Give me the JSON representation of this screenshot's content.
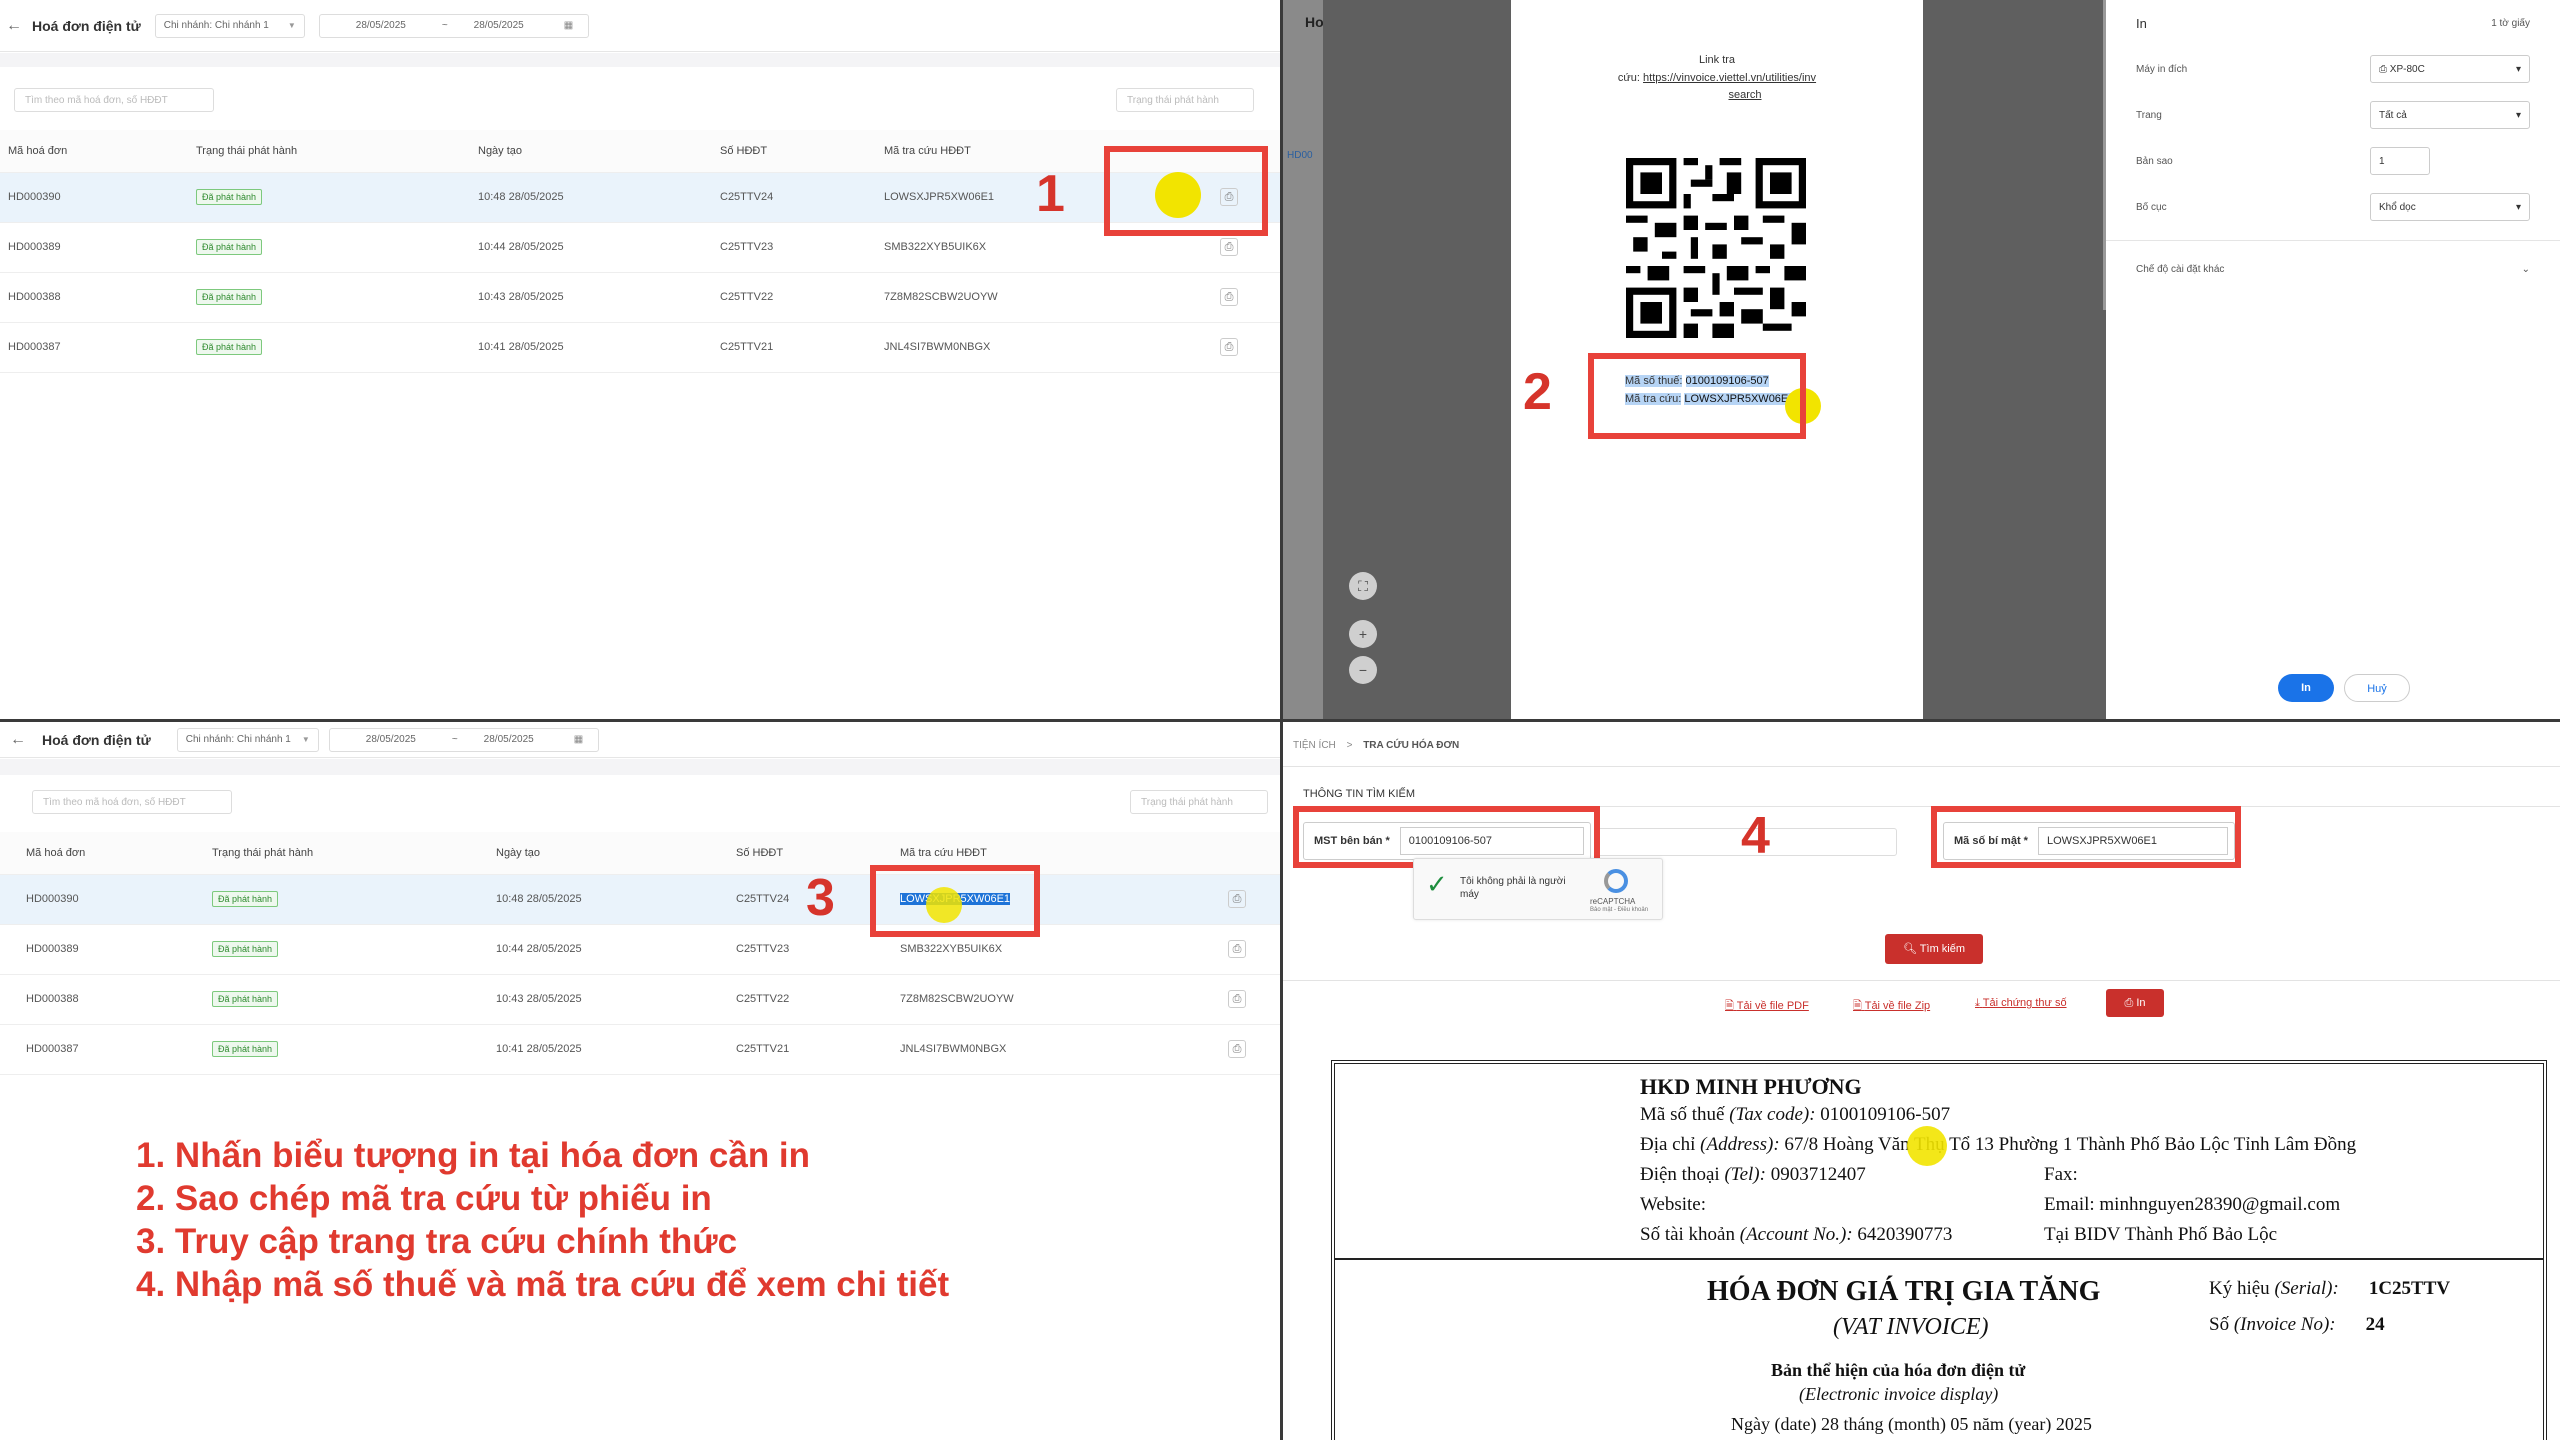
{
  "list": {
    "title": "Hoá đơn điện tử",
    "branch": "Chi nhánh: Chi nhánh 1",
    "date_from": "28/05/2025",
    "date_sep": "~",
    "date_to": "28/05/2025",
    "search_placeholder": "Tìm theo mã hoá đơn, số HĐĐT",
    "status_placeholder": "Trạng thái phát hành",
    "columns": [
      "Mã hoá đơn",
      "Trạng thái phát hành",
      "Ngày tạo",
      "Số HĐĐT",
      "Mã tra cứu HĐĐT"
    ],
    "rows": [
      {
        "code": "HD000390",
        "status": "Đã phát hành",
        "date": "10:48 28/05/2025",
        "number": "C25TTV24",
        "lookup": "LOWSXJPR5XW06E1"
      },
      {
        "code": "HD000389",
        "status": "Đã phát hành",
        "date": "10:44 28/05/2025",
        "number": "C25TTV23",
        "lookup": "SMB322XYB5UIK6X"
      },
      {
        "code": "HD000388",
        "status": "Đã phát hành",
        "date": "10:43 28/05/2025",
        "number": "C25TTV22",
        "lookup": "7Z8M82SCBW2UOYW"
      },
      {
        "code": "HD000387",
        "status": "Đã phát hành",
        "date": "10:41 28/05/2025",
        "number": "C25TTV21",
        "lookup": "JNL4SI7BWM0NBGX"
      }
    ]
  },
  "print_dialog": {
    "bg_title": "Ho",
    "bg_code": "HD00",
    "link_label": "Link tra",
    "link_label2": "cứu:",
    "link_url": "https://vinvoice.viettel.vn/utilities/inv",
    "link_url2": "search",
    "tax_label": "Mã số thuế:",
    "tax_value": "0100109106-507",
    "lookup_label": "Mã tra cứu:",
    "lookup_value": "LOWSXJPR5XW06E1",
    "panel_title": "In",
    "sheets": "1 tờ giấy",
    "printer_label": "Máy in đích",
    "printer_value": "XP-80C",
    "pages_label": "Trang",
    "pages_value": "Tất cả",
    "copies_label": "Bản sao",
    "copies_value": "1",
    "layout_label": "Bố cục",
    "layout_value": "Khổ dọc",
    "more_settings": "Chế độ cài đặt khác",
    "print_button": "In",
    "cancel_button": "Huỷ"
  },
  "annotations": {
    "n1": "1",
    "n2": "2",
    "n3": "3",
    "n4": "4"
  },
  "caption": [
    "1. Nhấn biểu tượng in tại hóa đơn cần in",
    "2. Sao chép mã tra cứu từ phiếu in",
    "3. Truy cập trang tra cứu chính thức",
    "4. Nhập mã số thuế và mã tra cứu để xem chi tiết"
  ],
  "lookup_page": {
    "crumb1": "TIỆN ÍCH",
    "crumb_sep": ">",
    "crumb2": "TRA CỨU HÓA ĐƠN",
    "section": "THÔNG TIN TÌM KIẾM",
    "mst_label": "MST bên bán *",
    "mst_value": "0100109106-507",
    "secret_label": "Mã số bí mật *",
    "secret_value": "LOWSXJPR5XW06E1",
    "captcha_text": "Tôi không phải là người máy",
    "captcha_brand": "reCAPTCHA",
    "captcha_terms": "Bảo mật - Điều khoản",
    "search_button": "Tìm kiếm",
    "dl_pdf": "Tải về file PDF",
    "dl_zip": "Tải về file Zip",
    "dl_cert": "Tải chứng thư số",
    "print_button": "In"
  },
  "invoice": {
    "company": "HKD MINH PHƯƠNG",
    "tax_line_a": "Mã số thuế ",
    "tax_line_b": "(Tax code):",
    "tax_line_c": " 0100109106-507",
    "addr_a": "Địa chỉ ",
    "addr_b": "(Address):",
    "addr_c": " 67/8 Hoàng Văn Thụ Tổ 13 Phường 1 Thành Phố Bảo Lộc Tỉnh Lâm Đồng",
    "tel_a": "Điện thoại ",
    "tel_b": "(Tel):",
    "tel_c": " 0903712407",
    "fax": "Fax:",
    "website": "Website:",
    "email": "Email: minhnguyen28390@gmail.com",
    "acc_a": "Số tài khoản ",
    "acc_b": "(Account No.):",
    "acc_c": " 6420390773",
    "bank": "Tại BIDV Thành Phố Bảo Lộc",
    "heading": "HÓA ĐƠN GIÁ TRỊ GIA TĂNG",
    "heading_en": "(VAT INVOICE)",
    "serial_a": "Ký hiệu ",
    "serial_b": "(Serial):",
    "serial_v": "1C25TTV",
    "no_a": "Số ",
    "no_b": "(Invoice No):",
    "no_v": "24",
    "display": "Bản thể hiện của hóa đơn điện tử",
    "display_en": "(Electronic invoice display)",
    "date_line": "Ngày (date) 28 tháng (month) 05 năm (year) 2025"
  }
}
